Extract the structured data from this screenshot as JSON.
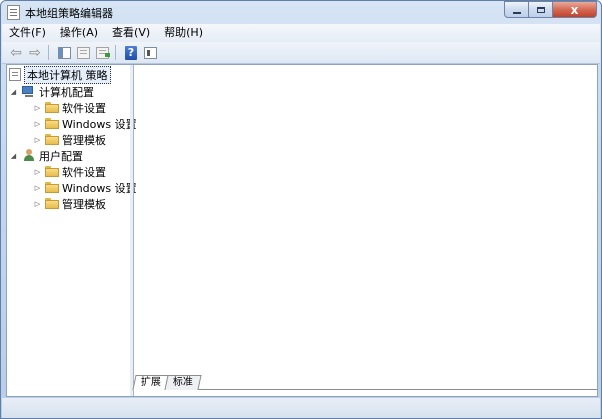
{
  "window": {
    "title": "本地组策略编辑器",
    "controls": {
      "minimize": "",
      "maximize": "",
      "close": "x"
    }
  },
  "menu": [
    {
      "label": "文件(F)"
    },
    {
      "label": "操作(A)"
    },
    {
      "label": "查看(V)"
    },
    {
      "label": "帮助(H)"
    }
  ],
  "toolbar": {
    "buttons": [
      "back-arrow-icon",
      "forward-arrow-icon",
      "show-tree-icon",
      "properties-icon",
      "export-list-icon",
      "help-icon",
      "extended-view-icon"
    ],
    "back_glyph": "⇦",
    "forward_glyph": "⇨",
    "help_glyph": "?"
  },
  "tree": {
    "root": "本地计算机 策略",
    "computer_config": {
      "label": "计算机配置",
      "children": [
        "软件设置",
        "Windows 设置",
        "管理模板"
      ]
    },
    "user_config": {
      "label": "用户配置",
      "children": [
        "软件设置",
        "Windows 设置",
        "管理模板"
      ]
    }
  },
  "tabs": [
    {
      "label": "扩展",
      "active": true
    },
    {
      "label": "标准",
      "active": false
    }
  ],
  "glyphs": {
    "expanded": "◢",
    "collapsed": "▷"
  },
  "colors": {
    "title_gradient_top": "#d6e4f4",
    "close_button": "#c2422a",
    "folder": "#e8bc4e",
    "selection_background": "#e5eefb"
  }
}
